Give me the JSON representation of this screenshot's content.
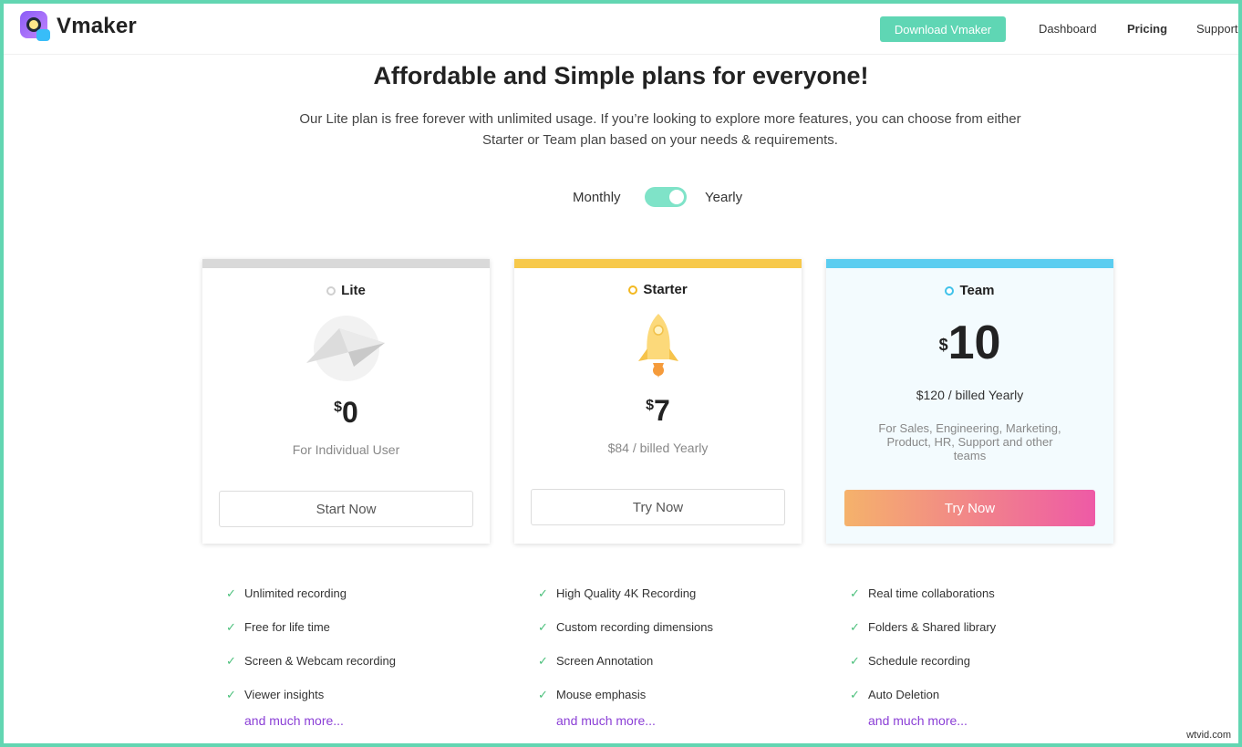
{
  "header": {
    "brand": "Vmaker",
    "download_label": "Download Vmaker",
    "nav": [
      "Dashboard",
      "Pricing",
      "Support"
    ]
  },
  "hero": {
    "title": "Affordable and Simple plans for everyone!",
    "subtitle": "Our Lite plan is free forever with unlimited usage. If you’re looking to explore more features, you can choose from either Starter or Team plan based on your needs & requirements."
  },
  "billing": {
    "monthly": "Monthly",
    "yearly": "Yearly"
  },
  "plans": [
    {
      "name": "Lite",
      "currency": "$",
      "price": "0",
      "note": "For Individual User",
      "button": "Start Now",
      "accent": "#d9d9d9",
      "features": [
        "Unlimited recording",
        "Free for life time",
        "Screen & Webcam recording",
        "Viewer insights"
      ],
      "more": "and much more..."
    },
    {
      "name": "Starter",
      "currency": "$",
      "price": "7",
      "note": "$84 / billed Yearly",
      "button": "Try Now",
      "accent": "#f7c94b",
      "features": [
        "High Quality 4K Recording",
        "Custom recording dimensions",
        "Screen Annotation",
        "Mouse emphasis"
      ],
      "more": "and much more..."
    },
    {
      "name": "Team",
      "currency": "$",
      "price": "10",
      "note": "$120 / billed Yearly",
      "audience": "For Sales, Engineering, Marketing, Product, HR, Support and other teams",
      "button": "Try Now",
      "accent": "#5bcdf0",
      "features": [
        "Real time collaborations",
        "Folders & Shared library",
        "Schedule recording",
        "Auto Deletion"
      ],
      "more": "and much more..."
    }
  ],
  "watermark": "wtvid.com"
}
